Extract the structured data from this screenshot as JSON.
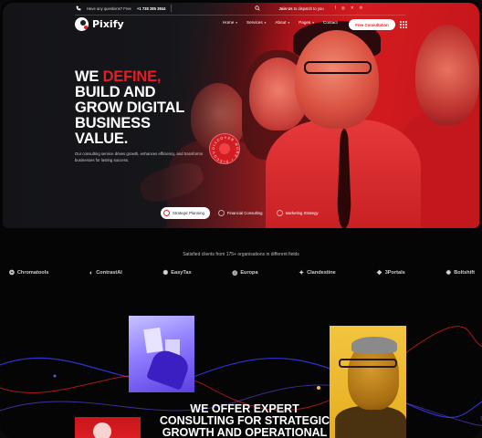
{
  "topbar": {
    "question_label": "Have any questions? Free",
    "phone": "+1 738 285 3844",
    "join_prefix": "Join Us",
    "join_text": "to dispatch to you"
  },
  "brand": {
    "name": "Pixify"
  },
  "nav": {
    "items": [
      {
        "label": "Home",
        "has_dropdown": true
      },
      {
        "label": "Services",
        "has_dropdown": true
      },
      {
        "label": "About",
        "has_dropdown": true
      },
      {
        "label": "Pages",
        "has_dropdown": true
      },
      {
        "label": "Contact",
        "has_dropdown": false
      }
    ],
    "cta": "Free Consultation"
  },
  "hero": {
    "headline_line1_white": "WE ",
    "headline_line1_red": "DEFINE,",
    "headline_line2": "BUILD AND",
    "headline_line3": "GROW DIGITAL",
    "headline_line4": "BUSINESS",
    "headline_line5": "VALUE.",
    "subtext": "Our consulting service drives growth, enhances efficiency, and transforms businesses for lasting success.",
    "badge_text": "DISCOVER MORE",
    "tabs": [
      {
        "label": "Strategic Planning",
        "active": true
      },
      {
        "label": "Financial Consulting",
        "active": false
      },
      {
        "label": "Marketing Strategy",
        "active": false
      }
    ]
  },
  "clients": {
    "title": "Satisfied clients from 175+ organisations in different fields",
    "logos": [
      {
        "name": "Chromatools",
        "icon": "swirl-icon"
      },
      {
        "name": "ContrastAI",
        "icon": "half-circle-icon"
      },
      {
        "name": "EasyTax",
        "icon": "spiral-icon"
      },
      {
        "name": "Europa",
        "icon": "globe-icon"
      },
      {
        "name": "Clandestine",
        "icon": "bolt-icon"
      },
      {
        "name": "3Portals",
        "icon": "portal-icon"
      },
      {
        "name": "Boltshift",
        "icon": "gear-icon"
      }
    ]
  },
  "services": {
    "title_line1": "WE OFFER EXPERT",
    "title_line2": "CONSULTING FOR STRATEGIC",
    "title_line3": "GROWTH AND OPERATIONAL"
  },
  "colors": {
    "accent_red": "#e21e26",
    "dark": "#1d1e23",
    "violet": "#6a4cff",
    "gold": "#f0c03a"
  }
}
